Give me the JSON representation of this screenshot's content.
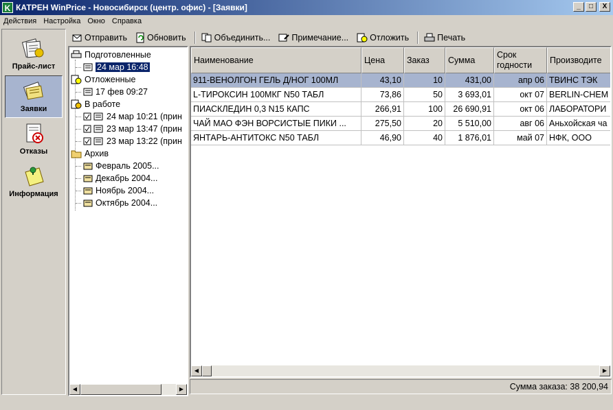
{
  "window": {
    "logo_letter": "K",
    "title": "КАТРЕН WinPrice - Новосибирск (центр. офис) - [Заявки]",
    "minimize": "_",
    "maximize": "□",
    "close": "X"
  },
  "menu": [
    "Действия",
    "Настройка",
    "Окно",
    "Справка"
  ],
  "sidebar": [
    {
      "label": "Прайс-лист",
      "icon": "price-list-icon",
      "active": false
    },
    {
      "label": "Заявки",
      "icon": "orders-icon",
      "active": true
    },
    {
      "label": "Отказы",
      "icon": "refusals-icon",
      "active": false
    },
    {
      "label": "Информация",
      "icon": "info-icon",
      "active": false
    }
  ],
  "toolbar": {
    "send": "Отправить",
    "refresh": "Обновить",
    "merge": "Объединить...",
    "note": "Примечание...",
    "postpone": "Отложить",
    "print": "Печать"
  },
  "tree": {
    "prepared": "Подготовленные",
    "prepared_items": [
      "24 мар 16:48"
    ],
    "postponed": "Отложенные",
    "postponed_items": [
      "17 фев 09:27"
    ],
    "in_work": "В работе",
    "in_work_items": [
      "24 мар 10:21 (прин",
      "23 мар 13:47 (прин",
      "23 мар 13:22 (прин"
    ],
    "archive": "Архив",
    "archive_items": [
      "Февраль 2005...",
      "Декабрь 2004...",
      "Ноябрь 2004...",
      "Октябрь 2004..."
    ]
  },
  "grid": {
    "columns": [
      "Наименование",
      "Цена",
      "Заказ",
      "Сумма",
      "Срок\nгодности",
      "Производите"
    ],
    "rows": [
      [
        "911-ВЕНОЛГОН ГЕЛЬ Д/НОГ 100МЛ",
        "43,10",
        "10",
        "431,00",
        "апр 06",
        "ТВИНС ТЭК"
      ],
      [
        "L-ТИРОКСИН 100МКГ N50 ТАБЛ",
        "73,86",
        "50",
        "3 693,01",
        "окт 07",
        "BERLIN-CHEM"
      ],
      [
        "ПИАСКЛЕДИН 0,3 N15 КАПС",
        "266,91",
        "100",
        "26 690,91",
        "окт 06",
        "ЛАБОРАТОРИ"
      ],
      [
        "ЧАЙ МАО ФЭН ВОРСИСТЫЕ ПИКИ ...",
        "275,50",
        "20",
        "5 510,00",
        "авг 06",
        "Аньхойская ча"
      ],
      [
        "ЯНТАРЬ-АНТИТОКС N50 ТАБЛ",
        "46,90",
        "40",
        "1 876,01",
        "май 07",
        "НФК, ООО"
      ]
    ],
    "selected_row": 0
  },
  "status": {
    "total": "Сумма заказа: 38 200,94"
  },
  "colors": {
    "title_start": "#0a246a",
    "title_end": "#a6caf0",
    "selection": "#a7b4cf",
    "tree_selection": "#0a246a",
    "face": "#d4d0c8"
  }
}
